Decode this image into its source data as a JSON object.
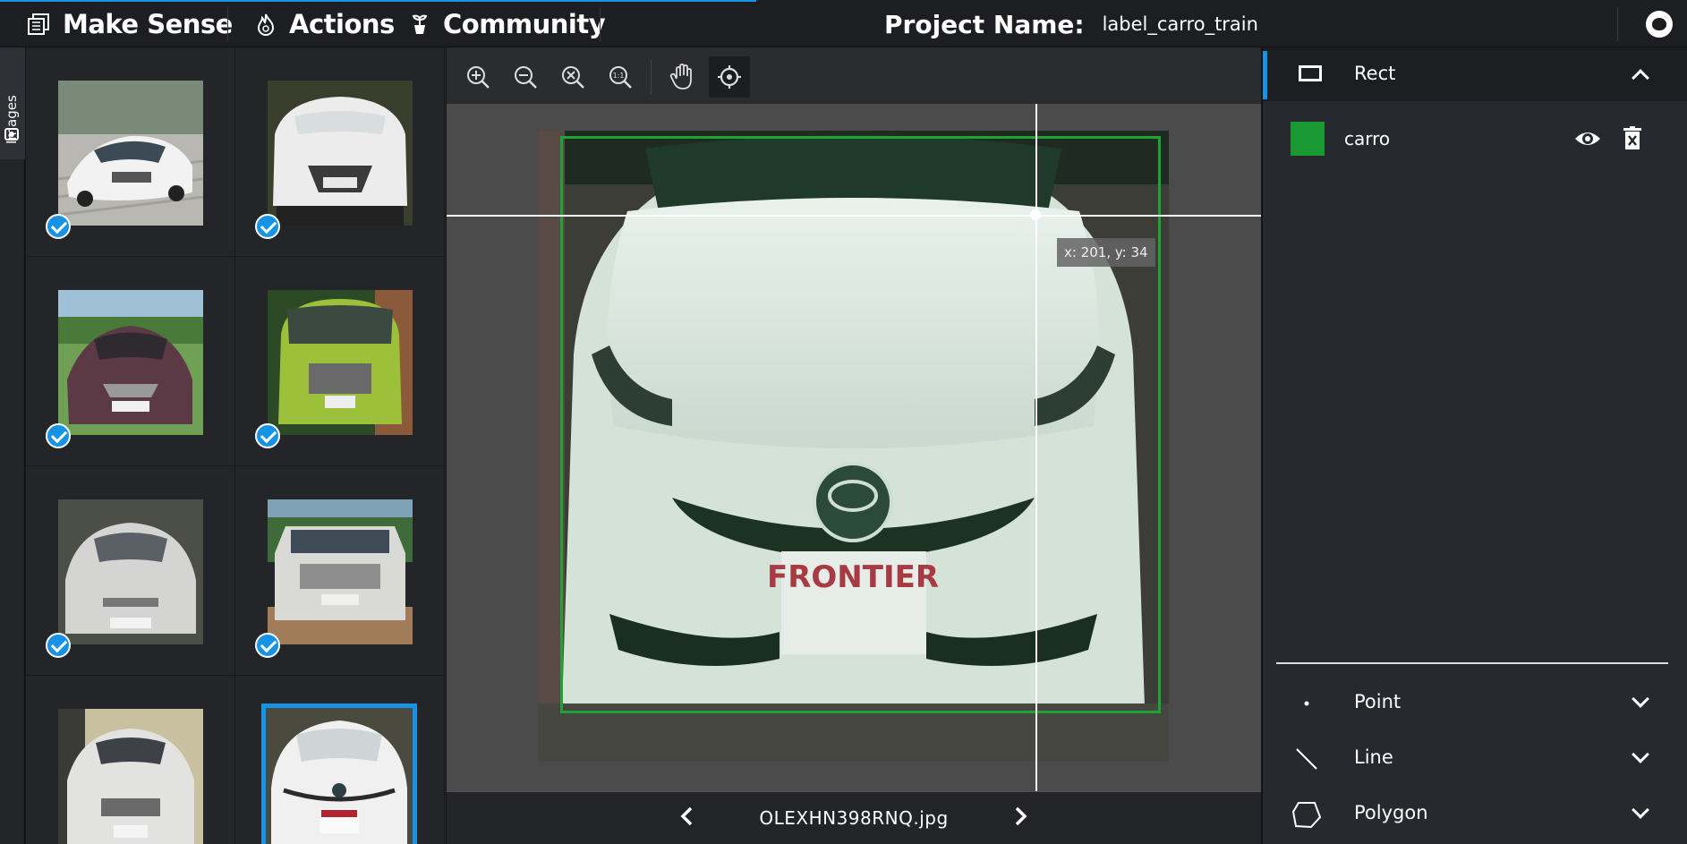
{
  "app": {
    "title": "Make Sense",
    "menu": [
      {
        "label": "Actions",
        "icon": "flame-icon"
      },
      {
        "label": "Community",
        "icon": "plant-icon"
      }
    ],
    "project_label": "Project Name:",
    "project_name": "label_carro_train"
  },
  "sidebar_tab": {
    "label": "Images",
    "icon": "camera-icon"
  },
  "thumbnails": [
    {
      "name": "white-sedan-1",
      "labeled": true,
      "active": false
    },
    {
      "name": "white-minivan-1",
      "labeled": true,
      "active": false
    },
    {
      "name": "maroon-sedan",
      "labeled": true,
      "active": false
    },
    {
      "name": "green-minivan",
      "labeled": true,
      "active": false
    },
    {
      "name": "silver-sedan",
      "labeled": true,
      "active": false
    },
    {
      "name": "silver-suv",
      "labeled": true,
      "active": false
    },
    {
      "name": "white-sedan-2",
      "labeled": false,
      "active": false
    },
    {
      "name": "white-hatchback-frontier",
      "labeled": false,
      "active": true
    }
  ],
  "toolbar": {
    "tools": [
      "zoom-in-icon",
      "zoom-out-icon",
      "zoom-fit-icon",
      "zoom-actual-size-icon",
      "hand-pan-icon",
      "crosshair-icon"
    ],
    "zoom_actual_label": "1:1",
    "active_tool": "crosshair-icon"
  },
  "editor": {
    "cursor_readout": "x: 201, y: 34",
    "plate_text": "FRONTIER",
    "filename": "OLEXHN398RNQ.jpg"
  },
  "right_panel": {
    "active_tool": {
      "label": "Rect",
      "icon": "rect-icon"
    },
    "labels": [
      {
        "name": "carro",
        "color": "#1b9a33"
      }
    ],
    "other_tools": [
      {
        "label": "Point",
        "icon": "point-icon"
      },
      {
        "label": "Line",
        "icon": "line-icon"
      },
      {
        "label": "Polygon",
        "icon": "polygon-icon"
      }
    ]
  },
  "colors": {
    "accent": "#1793e6",
    "bbox": "#1da434"
  }
}
